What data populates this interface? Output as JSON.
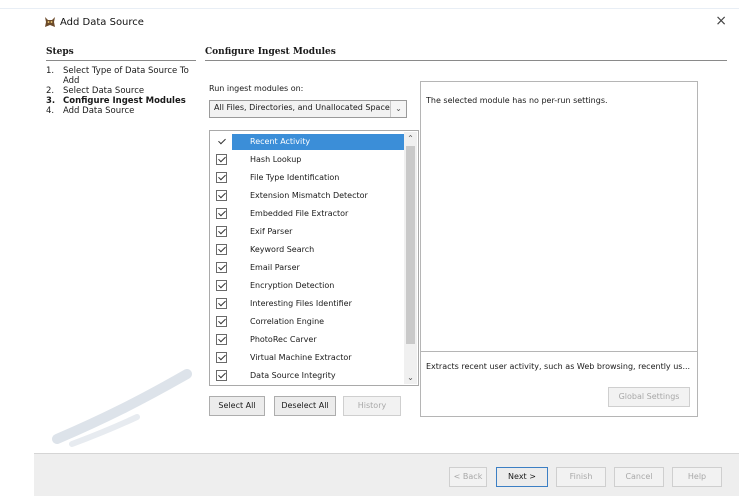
{
  "window": {
    "title": "Add Data Source",
    "close_glyph": "×"
  },
  "steps": {
    "heading": "Steps",
    "items": [
      {
        "num": "1.",
        "text": "Select Type of Data Source To Add",
        "active": false
      },
      {
        "num": "2.",
        "text": "Select Data Source",
        "active": false
      },
      {
        "num": "3.",
        "text": "Configure Ingest Modules",
        "active": true
      },
      {
        "num": "4.",
        "text": "Add Data Source",
        "active": false
      }
    ]
  },
  "main": {
    "heading": "Configure Ingest Modules",
    "run_label": "Run ingest modules on:",
    "run_select": "All Files, Directories, and Unallocated Space",
    "modules": [
      {
        "name": "Recent Activity",
        "checked": true,
        "selected": true
      },
      {
        "name": "Hash Lookup",
        "checked": true,
        "selected": false
      },
      {
        "name": "File Type Identification",
        "checked": true,
        "selected": false
      },
      {
        "name": "Extension Mismatch Detector",
        "checked": true,
        "selected": false
      },
      {
        "name": "Embedded File Extractor",
        "checked": true,
        "selected": false
      },
      {
        "name": "Exif Parser",
        "checked": true,
        "selected": false
      },
      {
        "name": "Keyword Search",
        "checked": true,
        "selected": false
      },
      {
        "name": "Email Parser",
        "checked": true,
        "selected": false
      },
      {
        "name": "Encryption Detection",
        "checked": true,
        "selected": false
      },
      {
        "name": "Interesting Files Identifier",
        "checked": true,
        "selected": false
      },
      {
        "name": "Correlation Engine",
        "checked": true,
        "selected": false
      },
      {
        "name": "PhotoRec Carver",
        "checked": true,
        "selected": false
      },
      {
        "name": "Virtual Machine Extractor",
        "checked": true,
        "selected": false
      },
      {
        "name": "Data Source Integrity",
        "checked": true,
        "selected": false
      }
    ],
    "buttons": {
      "select_all": "Select All",
      "deselect_all": "Deselect All",
      "history": "History"
    },
    "settings_message": "The selected module has no per-run settings.",
    "module_description": "Extracts recent user activity, such as Web browsing, recently us...",
    "global_settings": "Global Settings"
  },
  "footer": {
    "back": "< Back",
    "next": "Next >",
    "finish": "Finish",
    "cancel": "Cancel",
    "help": "Help"
  },
  "colors": {
    "selection": "#3b8ed8",
    "panel_border": "#b5b5b5",
    "footer_bg": "#eeeeee"
  }
}
